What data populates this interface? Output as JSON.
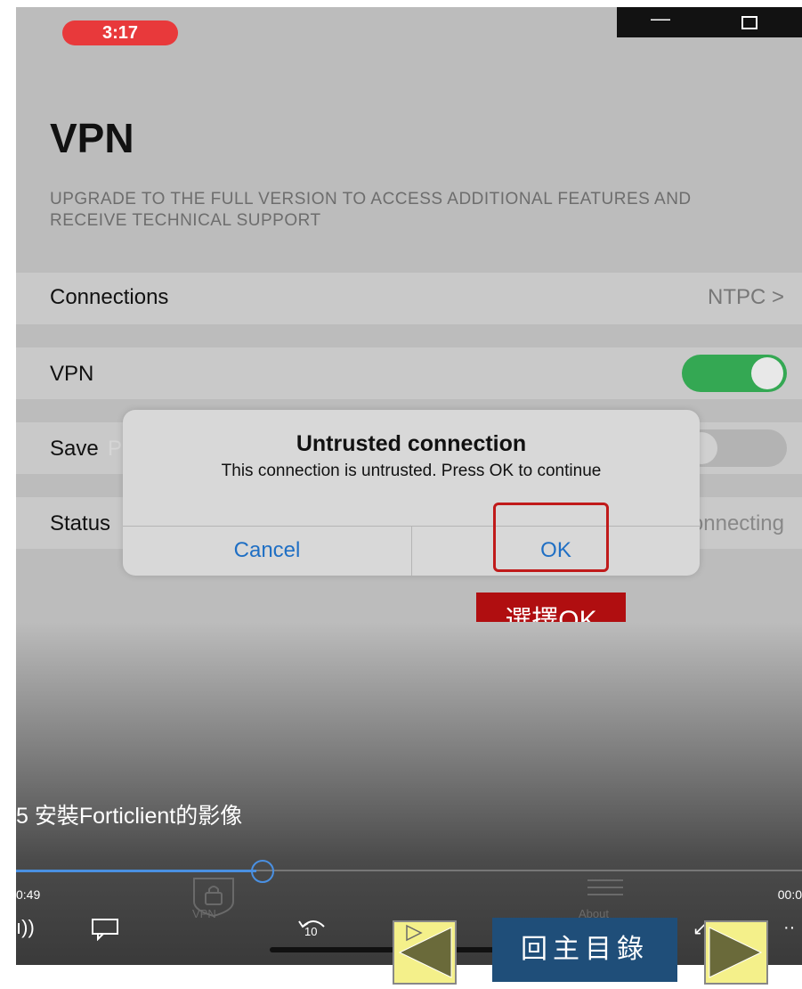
{
  "status": {
    "time": "3:17"
  },
  "page": {
    "title": "VPN",
    "upgrade_text": "UPGRADE TO THE FULL VERSION TO ACCESS ADDITIONAL FEATURES AND RECEIVE TECHNICAL SUPPORT"
  },
  "rows": {
    "connections_label": "Connections",
    "connections_value": "NTPC >",
    "vpn_label": "VPN",
    "vpn_enabled": true,
    "save_label": "Save",
    "save_hint": "Passw",
    "save_enabled": false,
    "status_label": "Status",
    "status_value": "Connecting"
  },
  "dialog": {
    "title": "Untrusted connection",
    "message": "This connection is untrusted. Press OK to continue",
    "cancel_label": "Cancel",
    "ok_label": "OK"
  },
  "annotation": {
    "callout": "選擇OK"
  },
  "video": {
    "subtitle": "5 安裝Forticlient的影像",
    "time_elapsed": "0:49",
    "time_remaining": "00:0",
    "progress": 0.31,
    "tab_vpn": "VPN",
    "tab_about": "About",
    "skip_label": "10"
  },
  "nav": {
    "back_home": "回主目錄"
  },
  "colors": {
    "toggle_on": "#34a853",
    "accent": "#1f6fc4",
    "callout": "#b00e10",
    "home_button": "#1f4e79"
  }
}
